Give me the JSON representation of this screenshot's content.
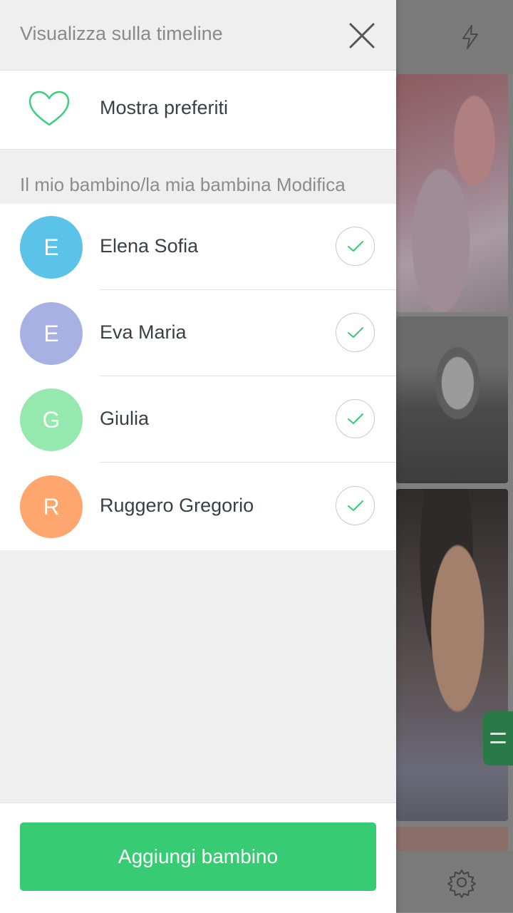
{
  "drawer": {
    "title": "Visualizza sulla timeline",
    "favorites_label": "Mostra preferiti",
    "section_header": "Il mio bambino/la mia bambina Modifica",
    "children": [
      {
        "initial": "E",
        "name": "Elena Sofia",
        "color": "#5cc3e8",
        "checked": true
      },
      {
        "initial": "E",
        "name": "Eva Maria",
        "color": "#a7b1e4",
        "checked": true
      },
      {
        "initial": "G",
        "name": "Giulia",
        "color": "#95e8ae",
        "checked": true
      },
      {
        "initial": "R",
        "name": "Ruggero Gregorio",
        "color": "#fea66d",
        "checked": true
      }
    ],
    "add_button": "Aggiungi bambino"
  },
  "colors": {
    "accent": "#37cc73",
    "check": "#37cc73",
    "heart": "#3ccf7e"
  },
  "icons": {
    "close": "close-icon",
    "favorites": "heart-icon",
    "check": "check-icon",
    "background_top": "bolt-icon",
    "background_bottom": "gear-icon"
  }
}
